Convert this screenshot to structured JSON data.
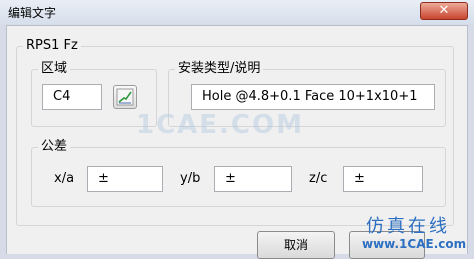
{
  "window": {
    "title": "编辑文字",
    "close_glyph": "✕"
  },
  "main_group": {
    "title": "RPS1 Fz"
  },
  "region": {
    "title": "区域",
    "value": "C4",
    "pick_icon": "curve-pick-icon"
  },
  "install": {
    "title": "安装类型/说明",
    "value": "Hole @4.8+0.1 Face 10+1x10+1"
  },
  "tolerance": {
    "title": "公差",
    "fields": [
      {
        "label": "x/a",
        "value": "±"
      },
      {
        "label": "y/b",
        "value": "±"
      },
      {
        "label": "z/c",
        "value": "±"
      }
    ]
  },
  "buttons": {
    "cancel": "取消"
  },
  "watermark": {
    "text": "1CAE.COM"
  },
  "logo": {
    "top": "仿真在线",
    "bottom": "www.1CAE.com"
  }
}
